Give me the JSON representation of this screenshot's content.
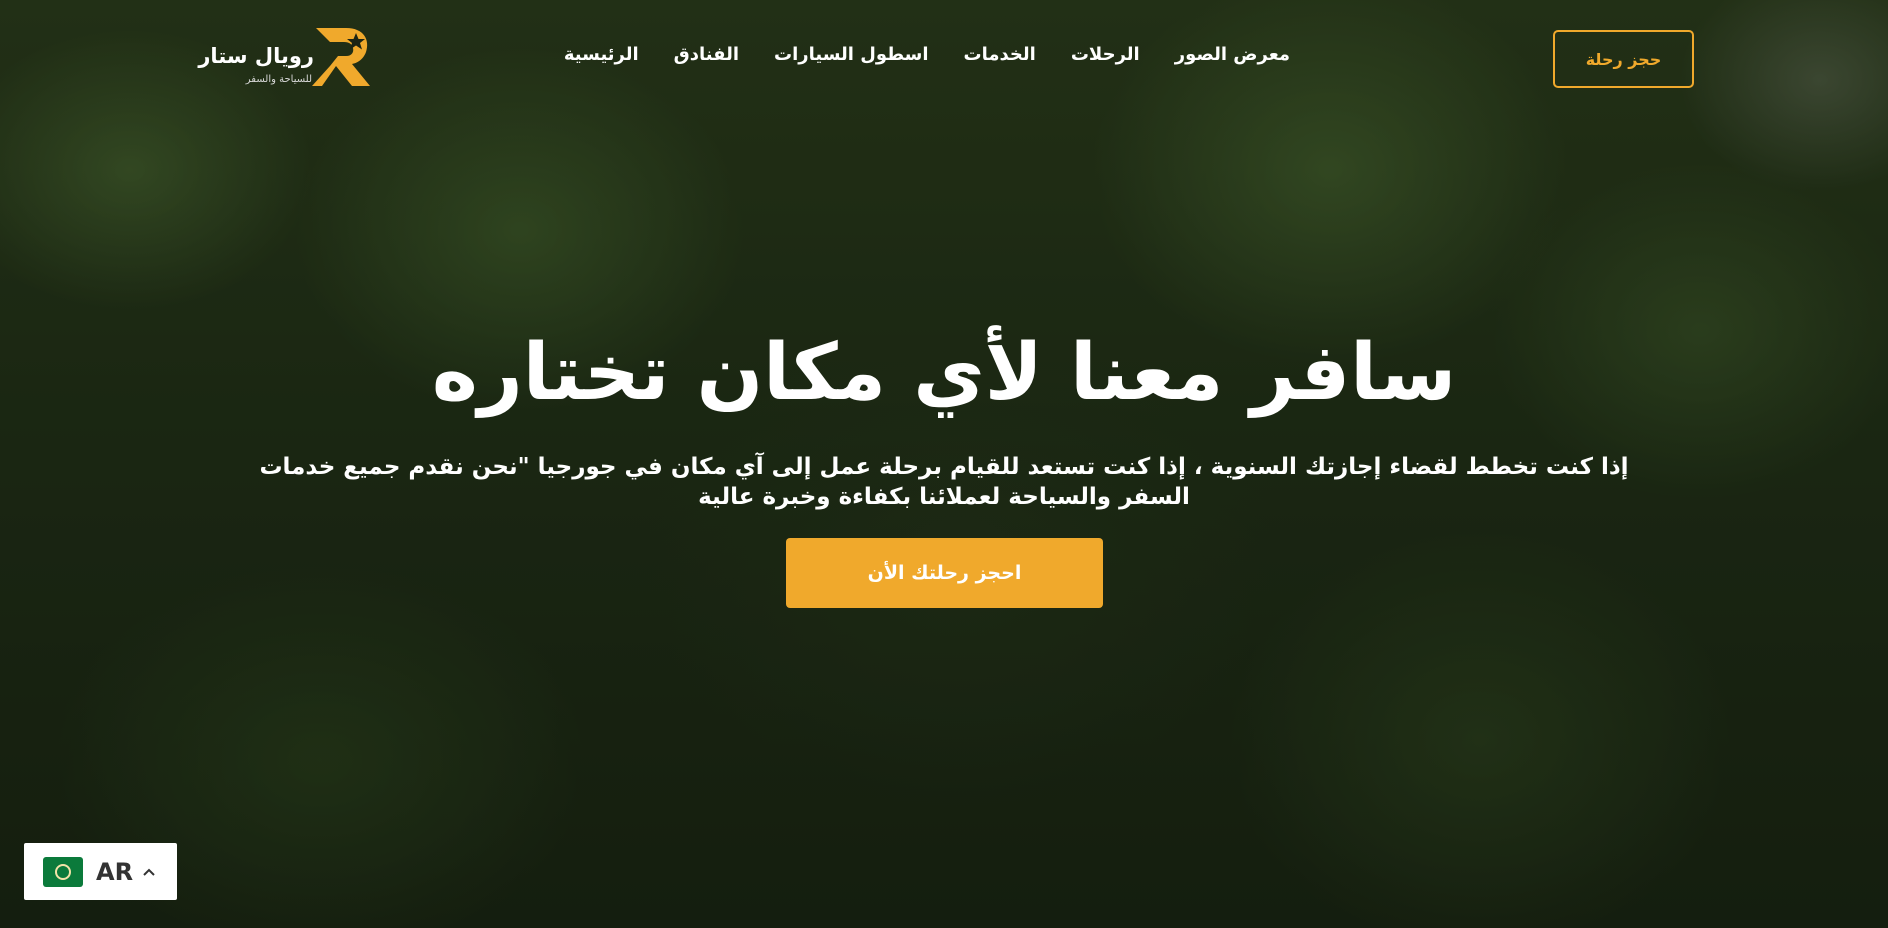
{
  "brand": {
    "name": "رويال ستار",
    "tagline": "للسياحة والسفر",
    "logo_letter": "R",
    "accent_color": "#f0a92c"
  },
  "nav": {
    "items": [
      {
        "label": "الرئيسية"
      },
      {
        "label": "الفنادق"
      },
      {
        "label": "اسطول السيارات"
      },
      {
        "label": "الخدمات"
      },
      {
        "label": "الرحلات"
      },
      {
        "label": "معرض الصور"
      }
    ]
  },
  "header": {
    "cta_label": "حجز رحلة"
  },
  "hero": {
    "title": "سافر معنا لأي مكان تختاره",
    "subtitle": "إذا كنت تخطط لقضاء إجازتك السنوية ، إذا كنت تستعد للقيام برحلة عمل إلى آي مكان في جورجيا \"نحن نقدم جميع خدمات السفر والسياحة لعملائنا بكفاءة وخبرة عالية",
    "cta_label": "احجز رحلتك الأن"
  },
  "language": {
    "code": "AR",
    "flag_icon": "arab-league-flag-icon",
    "chevron_icon": "chevron-up-icon"
  }
}
